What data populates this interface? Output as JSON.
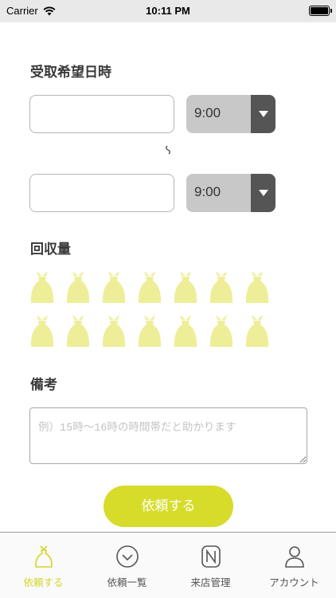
{
  "status_bar": {
    "carrier": "Carrier",
    "time": "10:11 PM"
  },
  "pickup": {
    "title": "受取希望日時",
    "start_date_value": "",
    "start_time": "9:00",
    "separator": "～",
    "end_date_value": "",
    "end_time": "9:00"
  },
  "collection": {
    "title": "回収量",
    "bag_count": 14,
    "bag_color": "#eeee99"
  },
  "remarks": {
    "title": "備考",
    "placeholder": "例）15時～16時の時間帯だと助かります"
  },
  "submit_label": "依頼する",
  "tabs": [
    {
      "label": "依頼する",
      "icon": "bag-icon",
      "active": true
    },
    {
      "label": "依頼一覧",
      "icon": "clock-icon",
      "active": false
    },
    {
      "label": "来店管理",
      "icon": "n-logo-icon",
      "active": false
    },
    {
      "label": "アカウント",
      "icon": "person-icon",
      "active": false
    }
  ],
  "colors": {
    "accent": "#d7dc2a",
    "active_tab": "#d4d42b",
    "select_bg": "#c8c8c8",
    "select_arrow_bg": "#555555"
  }
}
